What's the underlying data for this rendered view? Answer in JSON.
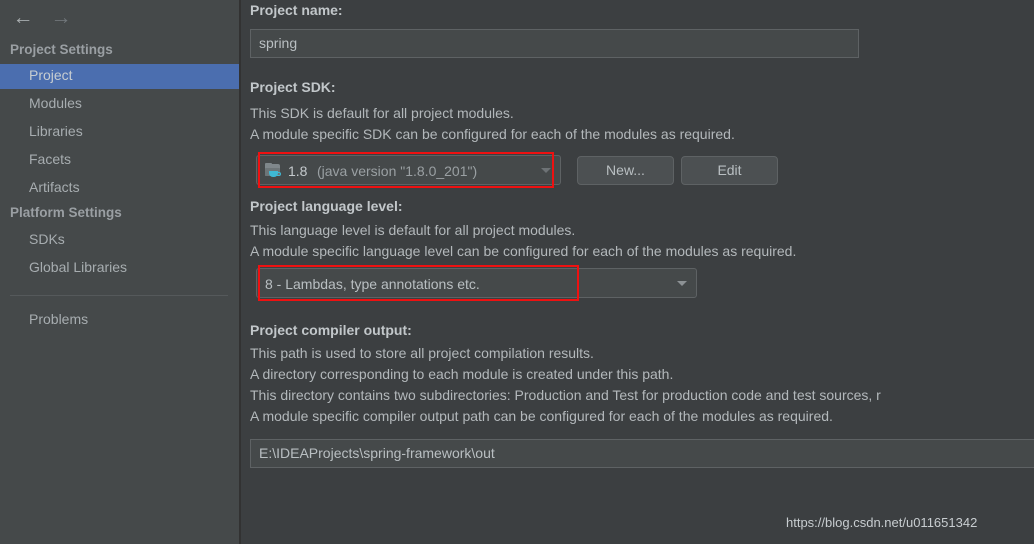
{
  "sidebar": {
    "nav": {
      "back_icon": "arrow-left-icon",
      "back_glyph": "←",
      "forward_icon": "arrow-right-icon",
      "forward_glyph": "→"
    },
    "sections": [
      {
        "header": "Project Settings",
        "items": [
          {
            "label": "Project",
            "selected": true
          },
          {
            "label": "Modules",
            "selected": false
          },
          {
            "label": "Libraries",
            "selected": false
          },
          {
            "label": "Facets",
            "selected": false
          },
          {
            "label": "Artifacts",
            "selected": false
          }
        ]
      },
      {
        "header": "Platform Settings",
        "items": [
          {
            "label": "SDKs",
            "selected": false
          },
          {
            "label": "Global Libraries",
            "selected": false
          }
        ]
      }
    ],
    "extra_items": [
      {
        "label": "Problems",
        "selected": false
      }
    ]
  },
  "main": {
    "project_name": {
      "label": "Project name:",
      "value": "spring",
      "placeholder": ""
    },
    "project_sdk": {
      "label": "Project SDK:",
      "description_lines": [
        "This SDK is default for all project modules.",
        "A module specific SDK can be configured for each of the modules as required."
      ],
      "icon": "java-sdk-folder-icon",
      "selected_name": "1.8",
      "selected_detail": "(java version \"1.8.0_201\")",
      "new_button": "New...",
      "edit_button": "Edit"
    },
    "project_language_level": {
      "label": "Project language level:",
      "description_lines": [
        "This language level is default for all project modules.",
        "A module specific language level can be configured for each of the modules as required."
      ],
      "selected": "8 - Lambdas, type annotations etc."
    },
    "project_compiler_output": {
      "label": "Project compiler output:",
      "description_lines": [
        "This path is used to store all project compilation results.",
        "A directory corresponding to each module is created under this path.",
        "This directory contains two subdirectories: Production and Test for production code and test sources, r",
        "A module specific compiler output path can be configured for each of the modules as required."
      ],
      "value": "E:\\IDEAProjects\\spring-framework\\out",
      "placeholder": ""
    }
  },
  "annotations": {
    "sdk_highlight": "red-rectangle",
    "language_level_highlight": "red-rectangle",
    "highlight_color": "#ee1111"
  },
  "watermark": {
    "text": "https://blog.csdn.net/u011651342"
  },
  "theme": {
    "background": "#3c3f41",
    "sidebar_background": "#45494a",
    "selection_blue": "#4b6eaf",
    "text": "#b3b8bb",
    "java_cup": "#3fb8d4"
  }
}
